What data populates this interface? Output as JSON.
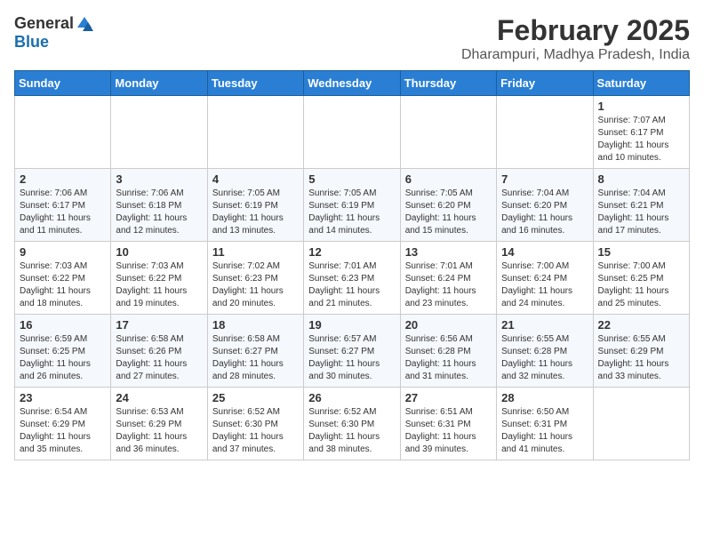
{
  "header": {
    "logo_general": "General",
    "logo_blue": "Blue",
    "month_title": "February 2025",
    "location": "Dharampuri, Madhya Pradesh, India"
  },
  "weekdays": [
    "Sunday",
    "Monday",
    "Tuesday",
    "Wednesday",
    "Thursday",
    "Friday",
    "Saturday"
  ],
  "weeks": [
    [
      {
        "day": "",
        "info": ""
      },
      {
        "day": "",
        "info": ""
      },
      {
        "day": "",
        "info": ""
      },
      {
        "day": "",
        "info": ""
      },
      {
        "day": "",
        "info": ""
      },
      {
        "day": "",
        "info": ""
      },
      {
        "day": "1",
        "info": "Sunrise: 7:07 AM\nSunset: 6:17 PM\nDaylight: 11 hours\nand 10 minutes."
      }
    ],
    [
      {
        "day": "2",
        "info": "Sunrise: 7:06 AM\nSunset: 6:17 PM\nDaylight: 11 hours\nand 11 minutes."
      },
      {
        "day": "3",
        "info": "Sunrise: 7:06 AM\nSunset: 6:18 PM\nDaylight: 11 hours\nand 12 minutes."
      },
      {
        "day": "4",
        "info": "Sunrise: 7:05 AM\nSunset: 6:19 PM\nDaylight: 11 hours\nand 13 minutes."
      },
      {
        "day": "5",
        "info": "Sunrise: 7:05 AM\nSunset: 6:19 PM\nDaylight: 11 hours\nand 14 minutes."
      },
      {
        "day": "6",
        "info": "Sunrise: 7:05 AM\nSunset: 6:20 PM\nDaylight: 11 hours\nand 15 minutes."
      },
      {
        "day": "7",
        "info": "Sunrise: 7:04 AM\nSunset: 6:20 PM\nDaylight: 11 hours\nand 16 minutes."
      },
      {
        "day": "8",
        "info": "Sunrise: 7:04 AM\nSunset: 6:21 PM\nDaylight: 11 hours\nand 17 minutes."
      }
    ],
    [
      {
        "day": "9",
        "info": "Sunrise: 7:03 AM\nSunset: 6:22 PM\nDaylight: 11 hours\nand 18 minutes."
      },
      {
        "day": "10",
        "info": "Sunrise: 7:03 AM\nSunset: 6:22 PM\nDaylight: 11 hours\nand 19 minutes."
      },
      {
        "day": "11",
        "info": "Sunrise: 7:02 AM\nSunset: 6:23 PM\nDaylight: 11 hours\nand 20 minutes."
      },
      {
        "day": "12",
        "info": "Sunrise: 7:01 AM\nSunset: 6:23 PM\nDaylight: 11 hours\nand 21 minutes."
      },
      {
        "day": "13",
        "info": "Sunrise: 7:01 AM\nSunset: 6:24 PM\nDaylight: 11 hours\nand 23 minutes."
      },
      {
        "day": "14",
        "info": "Sunrise: 7:00 AM\nSunset: 6:24 PM\nDaylight: 11 hours\nand 24 minutes."
      },
      {
        "day": "15",
        "info": "Sunrise: 7:00 AM\nSunset: 6:25 PM\nDaylight: 11 hours\nand 25 minutes."
      }
    ],
    [
      {
        "day": "16",
        "info": "Sunrise: 6:59 AM\nSunset: 6:25 PM\nDaylight: 11 hours\nand 26 minutes."
      },
      {
        "day": "17",
        "info": "Sunrise: 6:58 AM\nSunset: 6:26 PM\nDaylight: 11 hours\nand 27 minutes."
      },
      {
        "day": "18",
        "info": "Sunrise: 6:58 AM\nSunset: 6:27 PM\nDaylight: 11 hours\nand 28 minutes."
      },
      {
        "day": "19",
        "info": "Sunrise: 6:57 AM\nSunset: 6:27 PM\nDaylight: 11 hours\nand 30 minutes."
      },
      {
        "day": "20",
        "info": "Sunrise: 6:56 AM\nSunset: 6:28 PM\nDaylight: 11 hours\nand 31 minutes."
      },
      {
        "day": "21",
        "info": "Sunrise: 6:55 AM\nSunset: 6:28 PM\nDaylight: 11 hours\nand 32 minutes."
      },
      {
        "day": "22",
        "info": "Sunrise: 6:55 AM\nSunset: 6:29 PM\nDaylight: 11 hours\nand 33 minutes."
      }
    ],
    [
      {
        "day": "23",
        "info": "Sunrise: 6:54 AM\nSunset: 6:29 PM\nDaylight: 11 hours\nand 35 minutes."
      },
      {
        "day": "24",
        "info": "Sunrise: 6:53 AM\nSunset: 6:29 PM\nDaylight: 11 hours\nand 36 minutes."
      },
      {
        "day": "25",
        "info": "Sunrise: 6:52 AM\nSunset: 6:30 PM\nDaylight: 11 hours\nand 37 minutes."
      },
      {
        "day": "26",
        "info": "Sunrise: 6:52 AM\nSunset: 6:30 PM\nDaylight: 11 hours\nand 38 minutes."
      },
      {
        "day": "27",
        "info": "Sunrise: 6:51 AM\nSunset: 6:31 PM\nDaylight: 11 hours\nand 39 minutes."
      },
      {
        "day": "28",
        "info": "Sunrise: 6:50 AM\nSunset: 6:31 PM\nDaylight: 11 hours\nand 41 minutes."
      },
      {
        "day": "",
        "info": ""
      }
    ]
  ]
}
